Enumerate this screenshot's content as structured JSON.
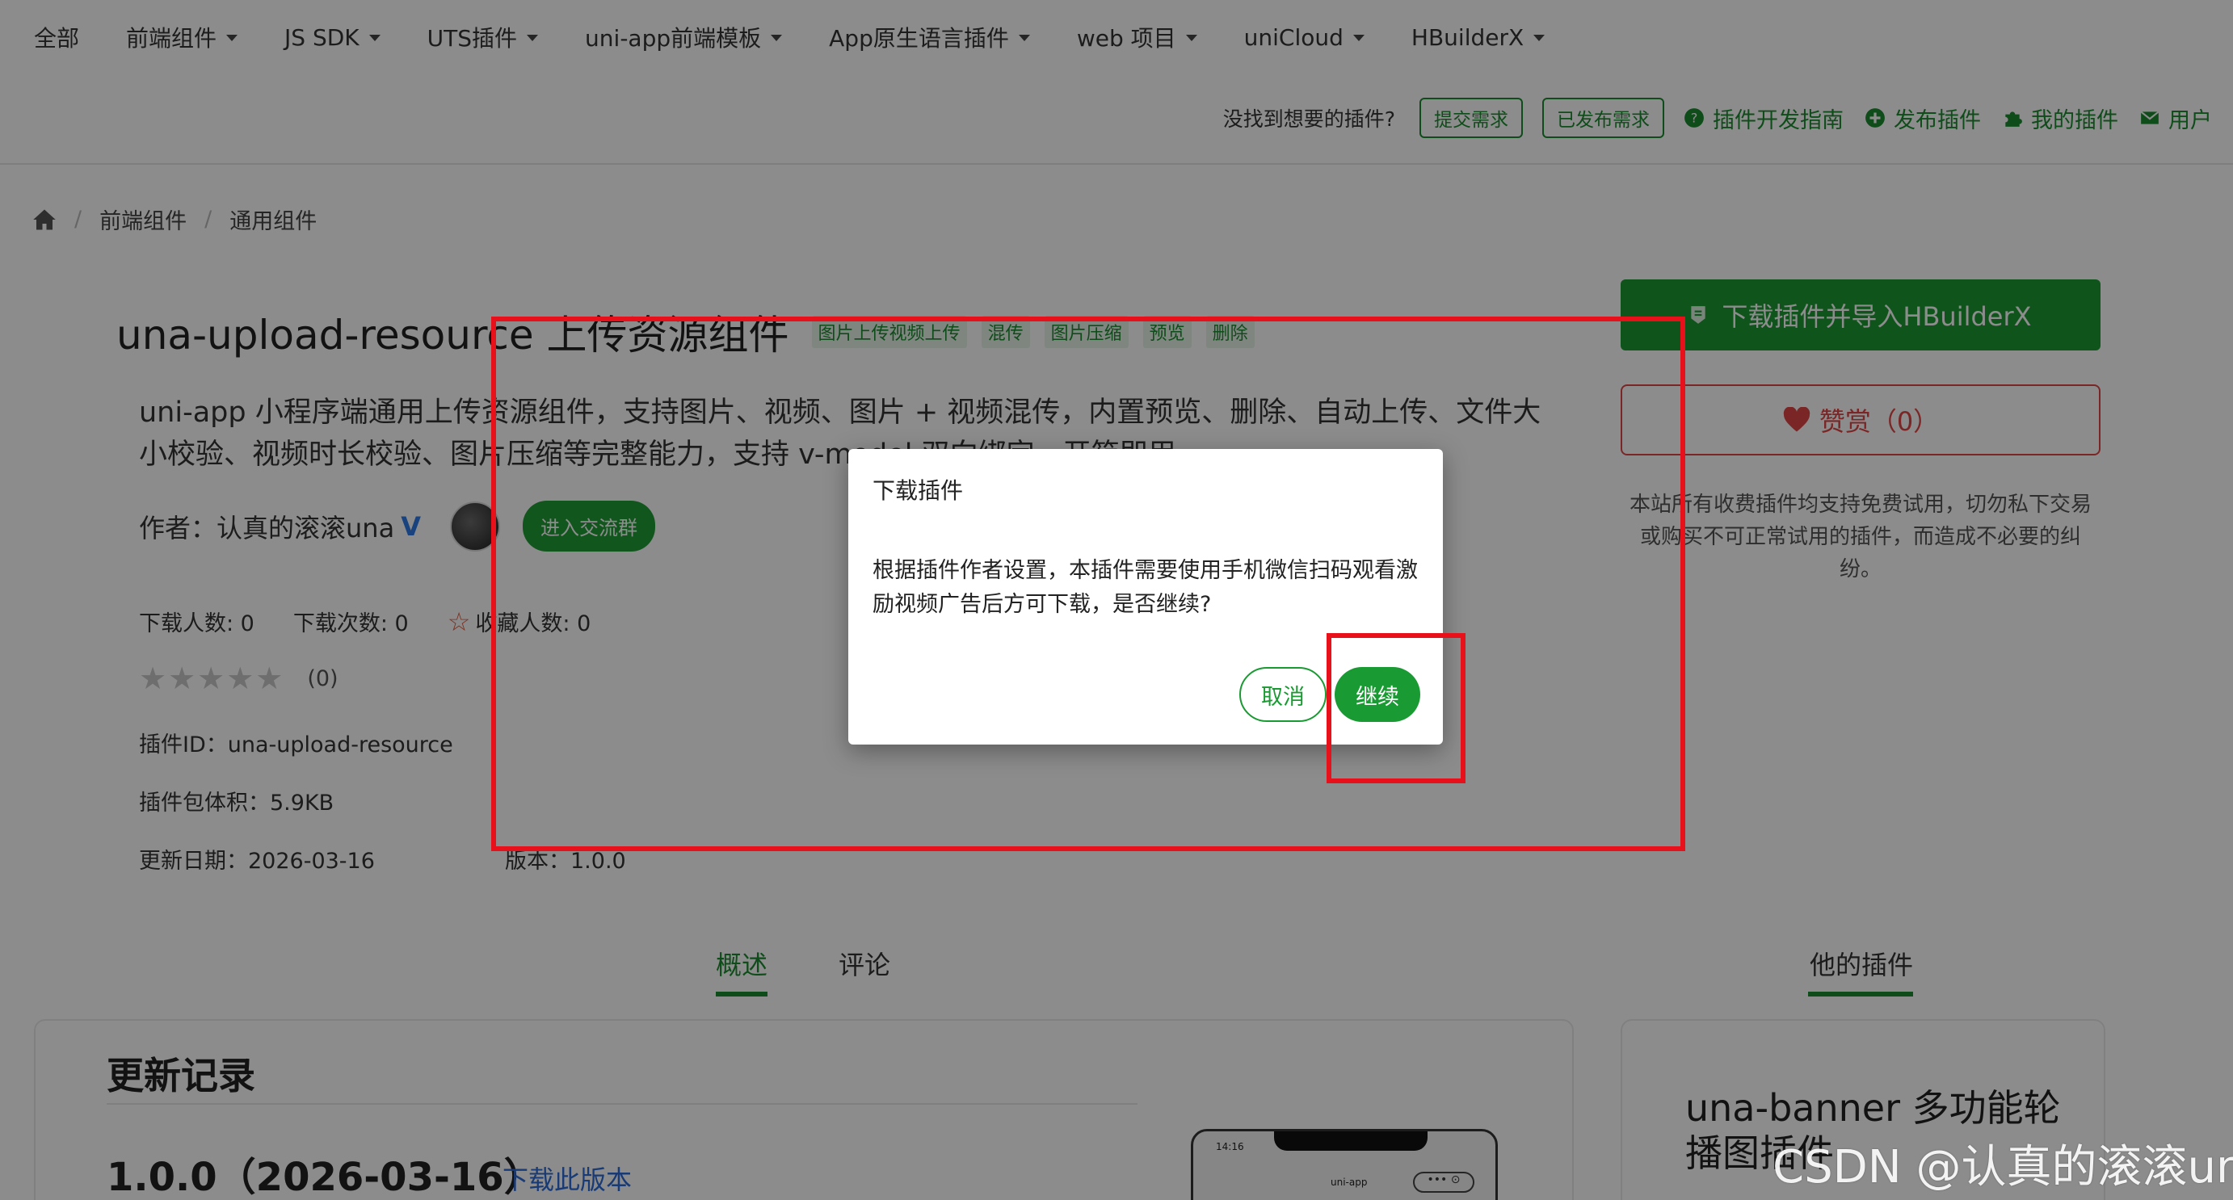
{
  "topnav": {
    "items": [
      {
        "label": "全部",
        "caret": false
      },
      {
        "label": "前端组件",
        "caret": true
      },
      {
        "label": "JS SDK",
        "caret": true
      },
      {
        "label": "UTS插件",
        "caret": true
      },
      {
        "label": "uni-app前端模板",
        "caret": true
      },
      {
        "label": "App原生语言插件",
        "caret": true
      },
      {
        "label": "web 项目",
        "caret": true
      },
      {
        "label": "uniCloud",
        "caret": true
      },
      {
        "label": "HBuilderX",
        "caret": true
      }
    ]
  },
  "subnav": {
    "ask": "没找到想要的插件?",
    "submit_request": "提交需求",
    "published_requests": "已发布需求",
    "dev_guide": "插件开发指南",
    "publish_plugin": "发布插件",
    "my_plugins": "我的插件",
    "user": "用户"
  },
  "breadcrumb": {
    "items": [
      "前端组件",
      "通用组件"
    ]
  },
  "plugin": {
    "title": "una-upload-resource 上传资源组件",
    "tags": [
      "图片上传视频上传",
      "混传",
      "图片压缩",
      "预览",
      "删除"
    ],
    "description": "uni-app 小程序端通用上传资源组件，支持图片、视频、图片 + 视频混传，内置预览、删除、自动上传、文件大小校验、视频时长校验、图片压缩等完整能力，支持 v-model 双向绑定，开箱即用。",
    "author_label": "作者：",
    "author_name": "认真的滚滚una",
    "author_verified": "V",
    "join_group": "进入交流群",
    "downloads_users": "下载人数: 0",
    "downloads_count": "下载次数: 0",
    "favorites": "收藏人数: 0",
    "rating_count": "(0)",
    "rating_value": 0,
    "plugin_id": "插件ID：una-upload-resource",
    "size": "插件包体积：5.9KB",
    "updated": "更新日期：2026-03-16",
    "version": "版本：1.0.0"
  },
  "sidebar": {
    "download_button": "下载插件并导入HBuilderX",
    "reward_button": "赞赏（0）",
    "notice": "本站所有收费插件均支持免费试用，切勿私下交易或购买不可正常试用的插件，而造成不必要的纠纷。"
  },
  "tabs": {
    "overview": "概述",
    "comments": "评论",
    "his_plugins": "他的插件"
  },
  "changelog": {
    "title": "更新记录",
    "version_line": "1.0.0（2026-03-16）",
    "download_version": "下载此版本"
  },
  "phone_preview": {
    "time": "14:16",
    "title": "uni-app",
    "capsule": "••• ⊙"
  },
  "other_plugin": {
    "title": "una-banner 多功能轮播图插件"
  },
  "dialog": {
    "title": "下载插件",
    "body": "根据插件作者设置，本插件需要使用手机微信扫码观看激励视频广告后方可下载，是否继续?",
    "cancel": "取消",
    "confirm": "继续"
  },
  "watermark": "CSDN @认真的滚滚una",
  "colors": {
    "brand_green": "#1a9a32",
    "annotation_red": "#e8101a",
    "reward_red": "#e04646",
    "link_blue": "#2d6bd6"
  }
}
